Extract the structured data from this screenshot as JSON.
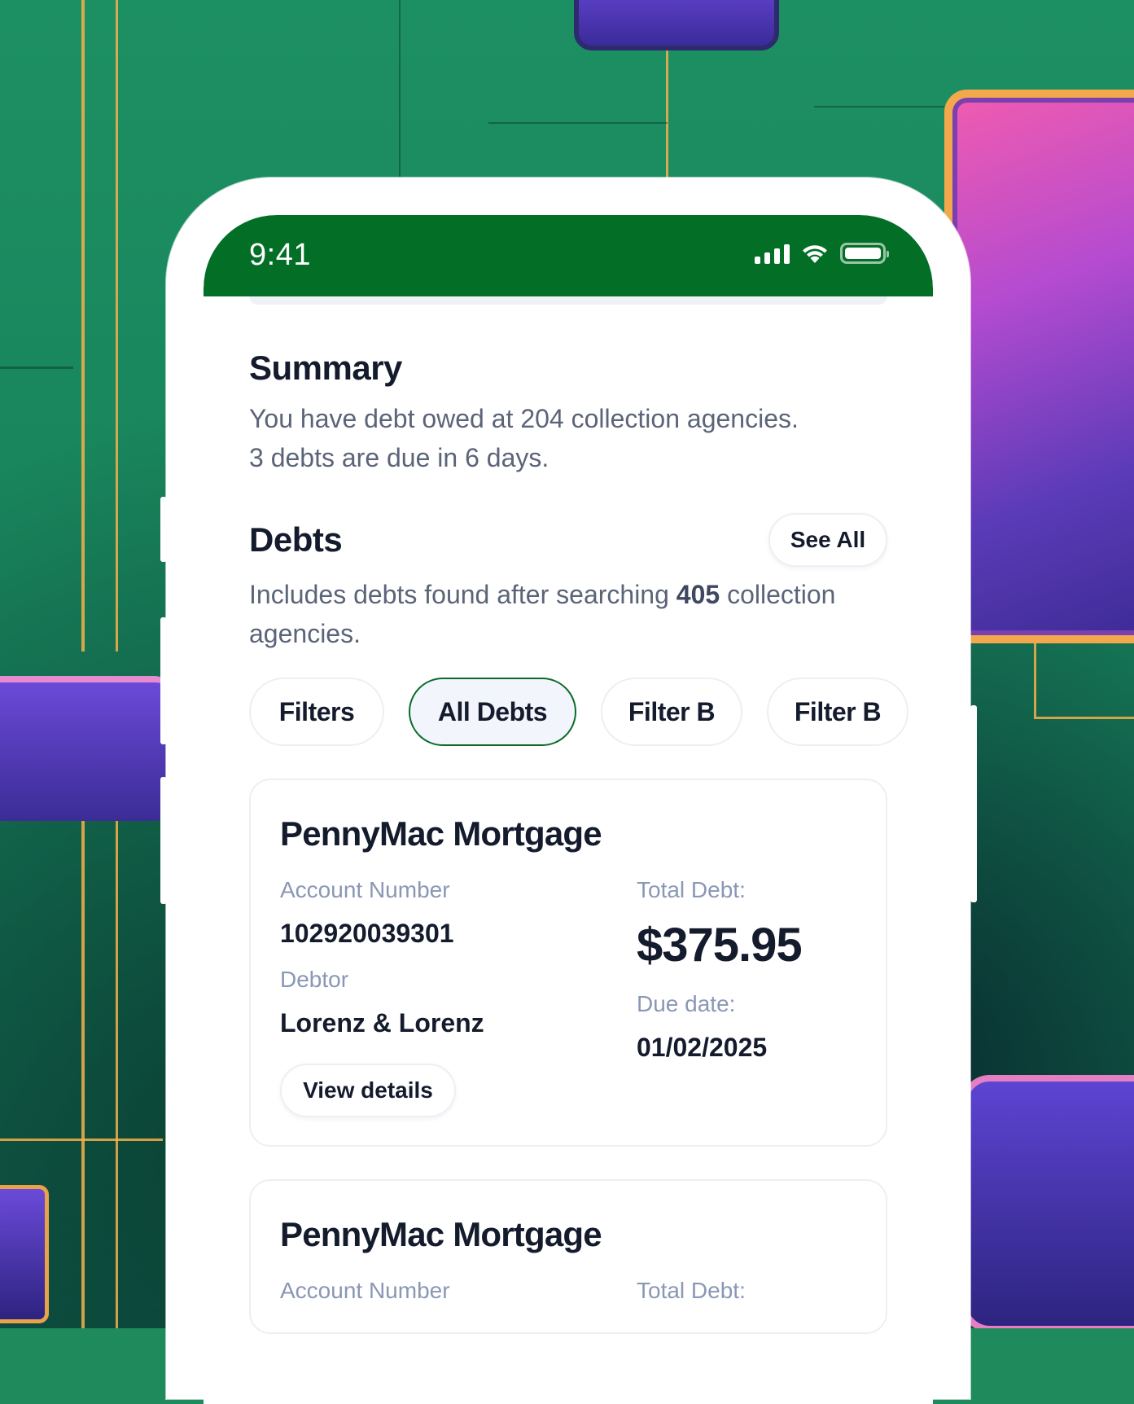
{
  "status_bar": {
    "time": "9:41",
    "signal_icon": "cellular-signal-icon",
    "wifi_icon": "wifi-icon",
    "battery_icon": "battery-icon",
    "color": "#036f26"
  },
  "summary": {
    "title": "Summary",
    "line1": "You have debt owed at 204 collection agencies.",
    "line2": "3 debts are due in 6 days."
  },
  "debts": {
    "title": "Debts",
    "see_all_label": "See All",
    "description_prefix": "Includes debts found after searching ",
    "description_count": "405",
    "description_suffix": " collection agencies."
  },
  "filters": [
    {
      "label": "Filters",
      "active": false
    },
    {
      "label": "All Debts",
      "active": true
    },
    {
      "label": "Filter B",
      "active": false
    },
    {
      "label": "Filter B",
      "active": false
    }
  ],
  "cards": [
    {
      "title": "PennyMac Mortgage",
      "account_label": "Account Number",
      "account_value": "102920039301",
      "debtor_label": "Debtor",
      "debtor_value": "Lorenz & Lorenz",
      "total_label": "Total Debt:",
      "total_value": "$375.95",
      "due_label": "Due date:",
      "due_value": "01/02/2025",
      "button_label": "View details"
    },
    {
      "title": "PennyMac Mortgage",
      "account_label": "Account Number",
      "total_label": "Total Debt:"
    }
  ],
  "colors": {
    "brand_green": "#036f26",
    "text_dark": "#141b2d",
    "text_muted": "#5b6478",
    "label": "#8a97b5"
  }
}
